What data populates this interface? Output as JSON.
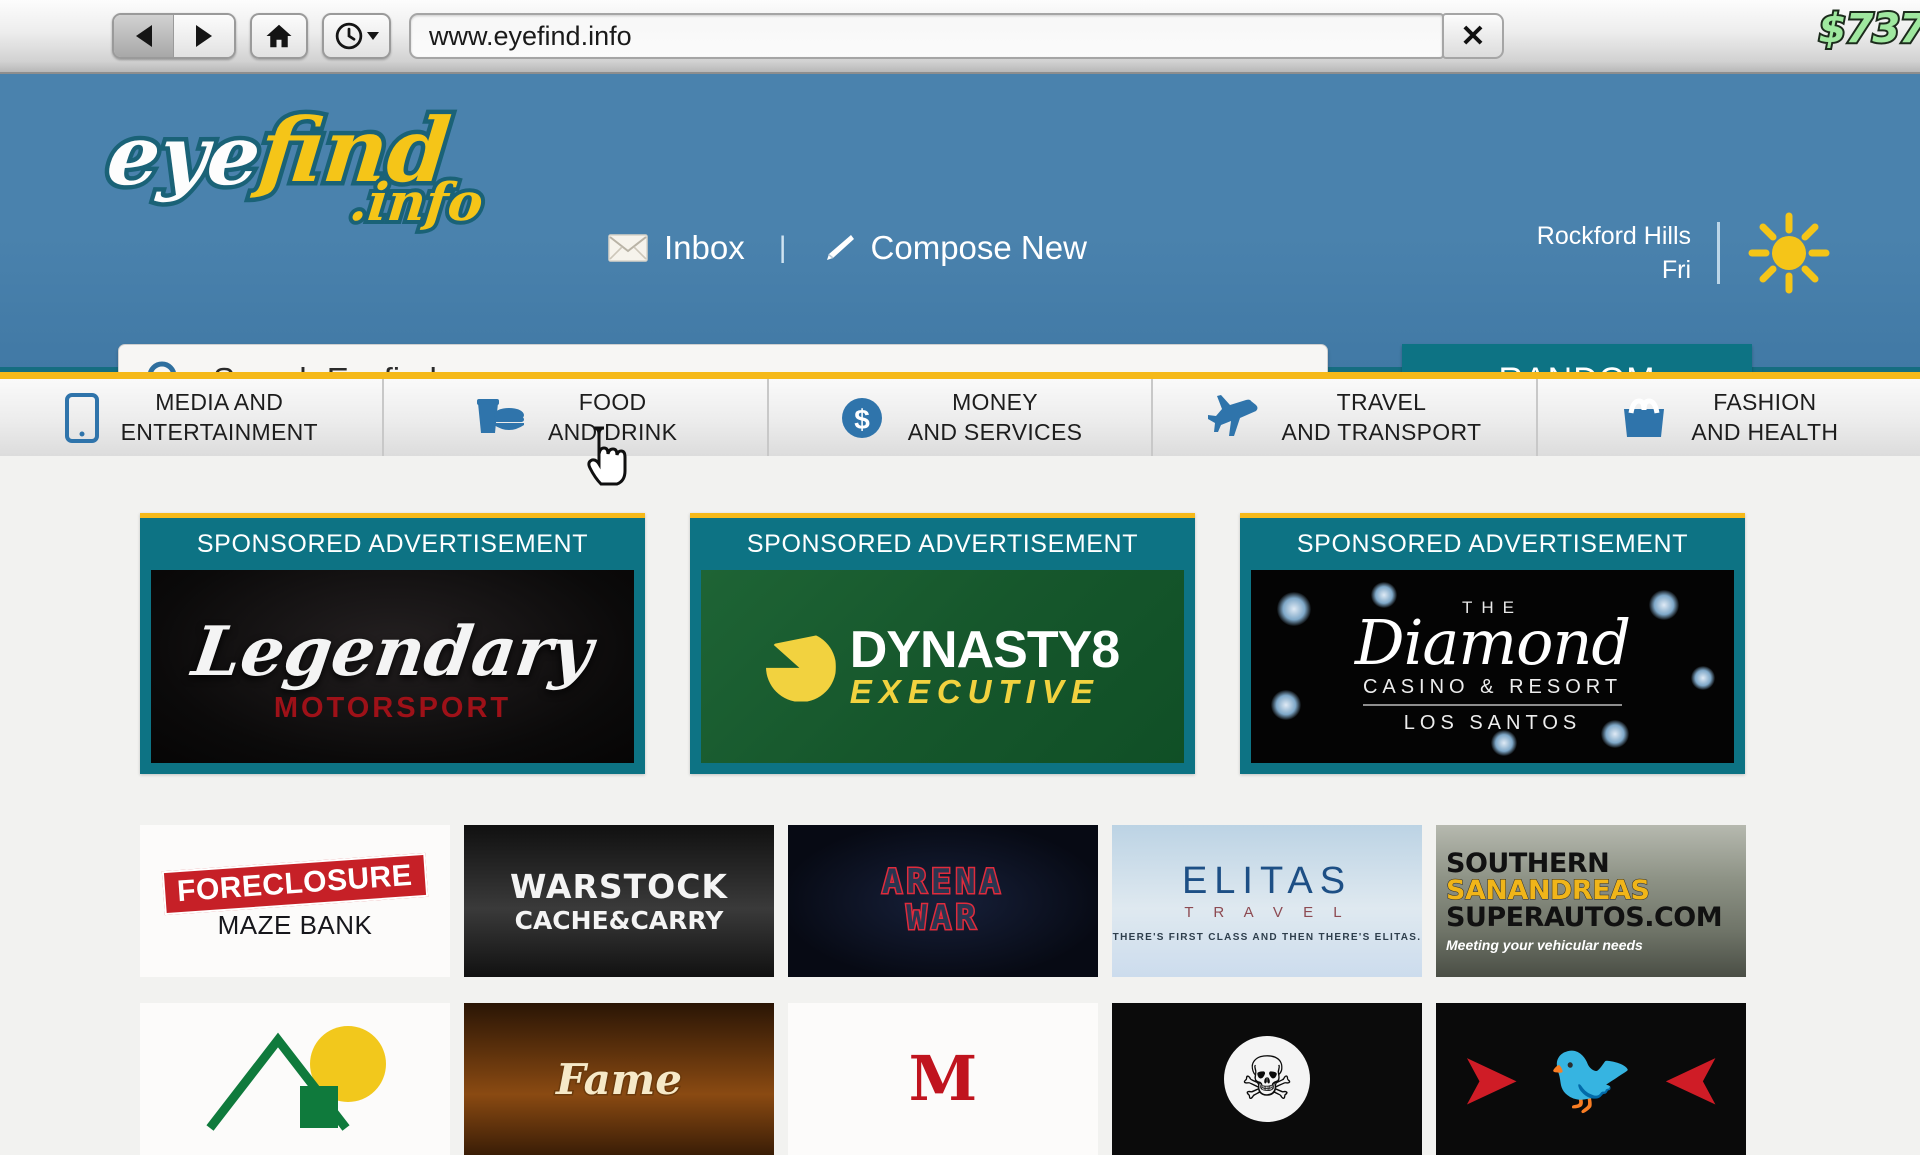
{
  "browser": {
    "back_icon": "triangle-left-icon",
    "forward_icon": "triangle-right-icon",
    "home_icon": "home-icon",
    "history_icon": "clock-icon",
    "url_value": "www.eyefind.info",
    "close_label": "✕",
    "money_hud": "$737"
  },
  "site": {
    "logo": {
      "part1": "eye",
      "part2": "find",
      "part3": ".info"
    },
    "links": [
      {
        "label": "Inbox",
        "icon": "envelope-icon"
      },
      {
        "label": "Compose New",
        "icon": "pencil-icon"
      }
    ],
    "separator": "|",
    "weather": {
      "city": "Rockford Hills",
      "day": "Fri",
      "icon": "sun-icon"
    },
    "search": {
      "placeholder": "Search Eyefind",
      "icon": "search-icon",
      "value": ""
    },
    "random_label": "RANDOM"
  },
  "categories": [
    {
      "line1": "MEDIA AND",
      "line2": "ENTERTAINMENT",
      "icon": "phone-icon"
    },
    {
      "line1": "FOOD",
      "line2": "AND DRINK",
      "icon": "food-drink-icon"
    },
    {
      "line1": "MONEY",
      "line2": "AND SERVICES",
      "icon": "dollar-coin-icon"
    },
    {
      "line1": "TRAVEL",
      "line2": "AND TRANSPORT",
      "icon": "airplane-icon"
    },
    {
      "line1": "FASHION",
      "line2": "AND HEALTH",
      "icon": "shopping-bag-icon"
    }
  ],
  "ads": {
    "header_label": "SPONSORED ADVERTISEMENT",
    "items": [
      {
        "name": "Legendary",
        "sub": "MOTORSPORT"
      },
      {
        "name_top": "DYNASTY8",
        "name_bottom": "EXECUTIVE"
      },
      {
        "the": "THE",
        "name": "Diamond",
        "sub": "CASINO & RESORT",
        "city": "LOS SANTOS"
      }
    ]
  },
  "tiles": [
    {
      "stamp": "FORECLOSURE",
      "name": "MAZE BANK"
    },
    {
      "line1": "WARSTOCK",
      "line2": "CACHE&CARRY"
    },
    {
      "line1": "ARENA",
      "line2": "WAR"
    },
    {
      "name": "ELITAS",
      "sub": "T R A V E L",
      "tagline": "THERE'S FIRST CLASS AND THEN THERE'S ELITAS."
    },
    {
      "line1": "SOUTHERN",
      "line2": "SANANDREAS",
      "line3": "SUPERAUTOS.COM",
      "tagline": "Meeting your vehicular needs"
    },
    {
      "name": "house-icon"
    },
    {
      "name": "Fame"
    },
    {
      "name": "M"
    },
    {
      "name": "skull-icon"
    },
    {
      "name": "eagle-icon"
    }
  ],
  "colors": {
    "header_blue": "#4a82ad",
    "teal": "#0d7384",
    "yellow": "#f5b91a",
    "money_green": "#9fe89f"
  }
}
